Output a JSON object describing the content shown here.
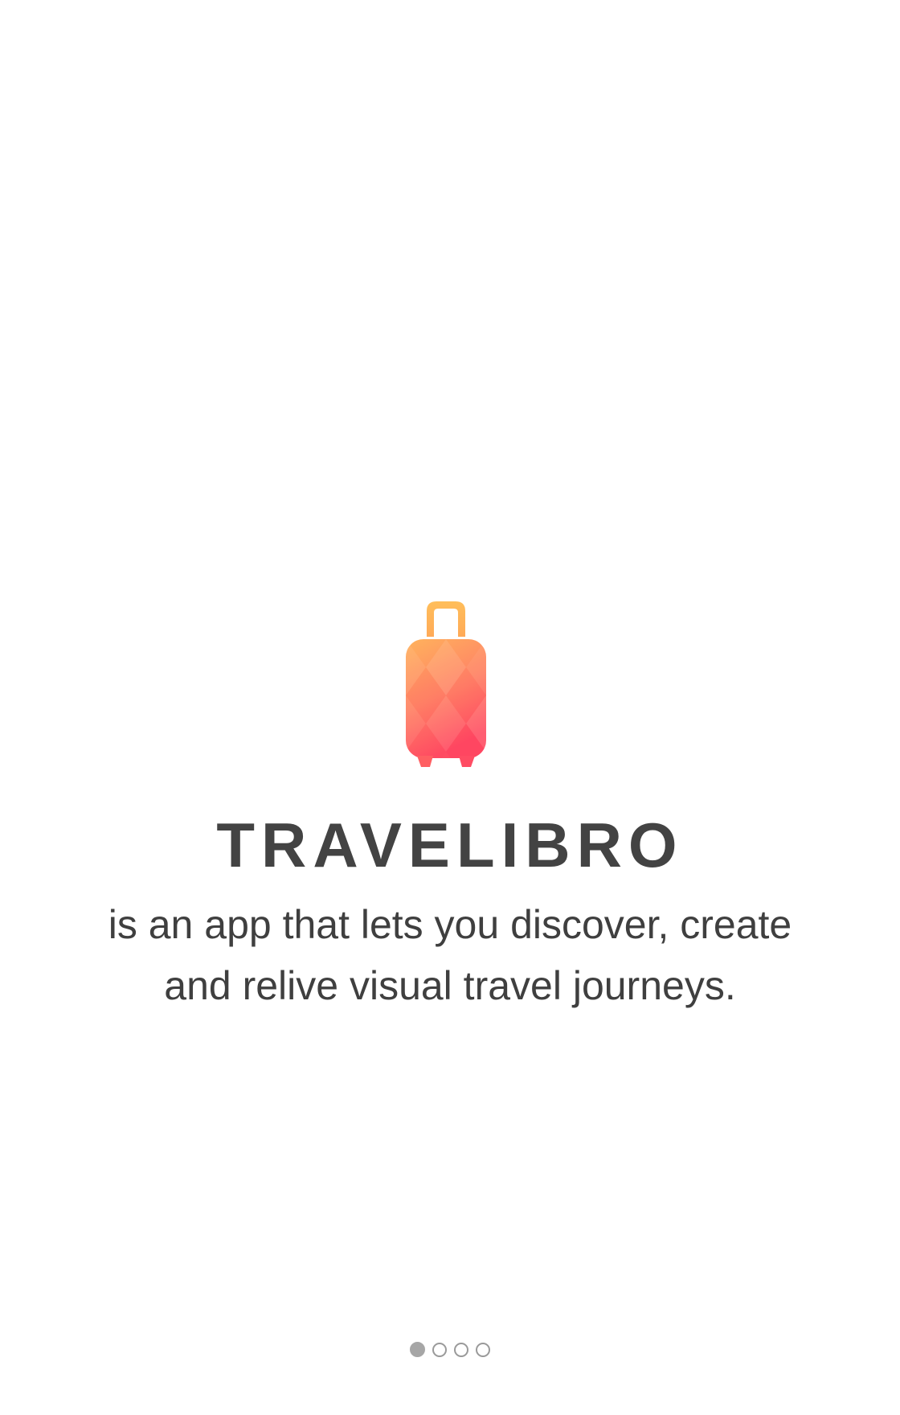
{
  "onboarding": {
    "app_name": "TRAVELIBRO",
    "tagline_line1": "is an app that lets you discover, create",
    "tagline_line2": "and relive visual travel journeys.",
    "logo_icon": "suitcase-icon",
    "pager": {
      "total_pages": 4,
      "current_page": 1
    }
  },
  "colors": {
    "logo_gradient_top": "#FFB15E",
    "logo_gradient_bottom": "#FF4C63",
    "title_text": "#434343",
    "body_text": "#3F3F3F",
    "dot_color": "#A6A6A6"
  }
}
